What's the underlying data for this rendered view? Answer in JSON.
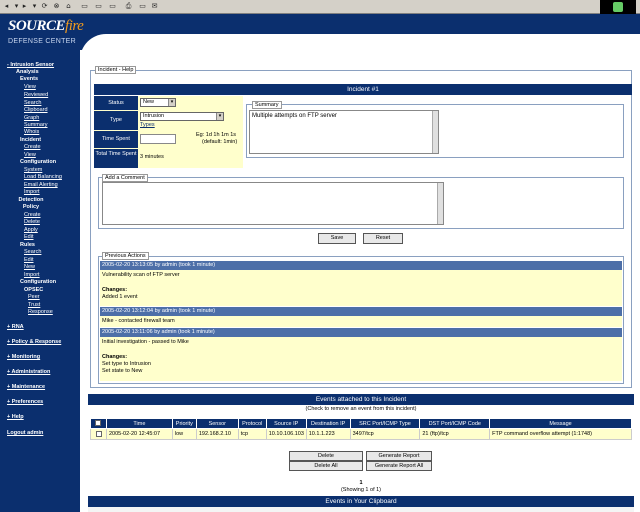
{
  "header": {
    "brand_main": "SOURCE",
    "brand_accent": "fire",
    "brand_sub": "DEFENSE CENTER"
  },
  "sidebar": {
    "intrusion_sensor": "- Intrusion Sensor",
    "analysis": "Analysis",
    "events": "Events",
    "view": "View",
    "reviewed": "Reviewed",
    "search": "Search",
    "clipboard": "Clipboard",
    "graph": "Graph",
    "summary": "Summary",
    "whois": "Whois",
    "incident": "Incident",
    "create": "Create",
    "view2": "View",
    "configuration": "Configuration",
    "system": "System",
    "load_balancing": "Load Balancing",
    "email_alerting": "Email Alerting",
    "import": "Import",
    "detection_policy": "Detection Policy",
    "create2": "Create",
    "delete": "Delete",
    "apply": "Apply",
    "edit": "Edit",
    "rules": "Rules",
    "search2": "Search",
    "edit2": "Edit",
    "new": "New",
    "import2": "Import",
    "configuration2": "Configuration",
    "opsec": "OPSEC",
    "peer": "Peer",
    "trust": "Trust",
    "response": "Response",
    "rna": "+ RNA",
    "policy_response": "+ Policy & Response",
    "monitoring": "+ Monitoring",
    "administration": "+ Administration",
    "maintenance": "+ Maintenance",
    "preferences": "+ Preferences",
    "help": "+ Help",
    "logout": "Logout admin"
  },
  "incident": {
    "legend": "Incident - Help",
    "title": "Incident #1",
    "status_label": "Status",
    "status_value": "New",
    "type_label": "Type",
    "type_value": "Intrusion",
    "types_link": "Types",
    "time_spent_label": "Time Spent",
    "time_spent_hint": "Eg: 1d 1h 1m 1s",
    "time_spent_default": "(default: 1min)",
    "total_time_label": "Total Time Spent",
    "total_time_value": "3 minutes",
    "summary_legend": "Summary",
    "summary_text": "Multiple attempts on FTP server",
    "comment_legend": "Add a Comment",
    "save_button": "Save",
    "reset_button": "Reset"
  },
  "previous_actions": {
    "legend": "Previous Actions",
    "items": [
      {
        "header": "2005-02-20 13:13:05 by admin (took 1 minute)",
        "line1": "Vulnerability scan of FTP server",
        "changes_label": "Changes:",
        "change1": "Added 1 event",
        "change2": ""
      },
      {
        "header": "2005-02-20 13:12:04 by admin (took 1 minute)",
        "line1": "Mike - contacted firewall team",
        "changes_label": "",
        "change1": "",
        "change2": ""
      },
      {
        "header": "2005-02-20 13:11:06 by admin (took 1 minute)",
        "line1": "Initial investigation - passed to Mike",
        "changes_label": "Changes:",
        "change1": "Set type to Intrusion",
        "change2": "Set state to New"
      }
    ]
  },
  "events": {
    "title": "Events attached to this Incident",
    "subtitle": "(Check to remove an event from this incident)",
    "columns": [
      "",
      "Time",
      "Priority",
      "Sensor",
      "Protocol",
      "Source IP",
      "Destination IP",
      "SRC Port/ICMP Type",
      "DST Port/ICMP Code",
      "Message"
    ],
    "rows": [
      [
        "",
        "2005-02-20 12:45:07",
        "low",
        "192.168.2.10",
        "tcp",
        "10.10.106.103",
        "10.1.1.223",
        "3497/tcp",
        "21 (ftp)/tcp",
        "FTP command overflow attempt (1:1748)"
      ]
    ],
    "delete_button": "Delete",
    "delete_all_button": "Delete All",
    "generate_report_button": "Generate Report",
    "generate_report_all_button": "Generate Report All",
    "page_number": "1",
    "showing": "(Showing 1 of 1)"
  },
  "clipboard": {
    "title": "Events in Your Clipboard"
  }
}
